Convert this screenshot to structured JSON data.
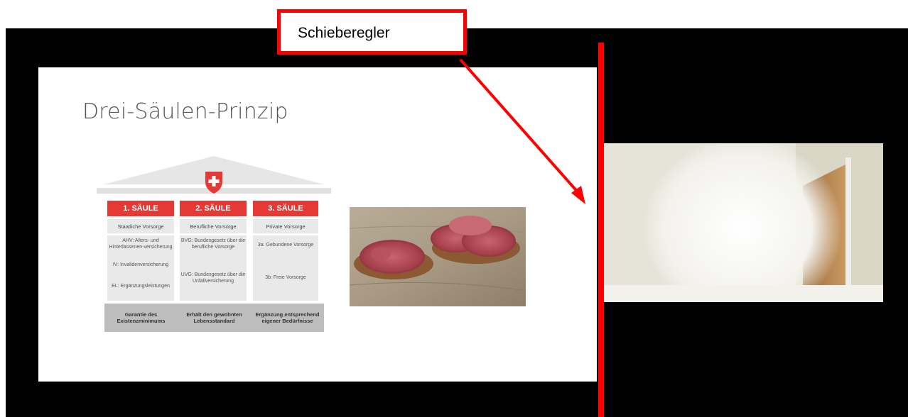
{
  "callout": {
    "label": "Schieberegler"
  },
  "slide": {
    "title": "Drei-Säulen-Prinzip",
    "columns": [
      {
        "header": "1. SÄULE",
        "subheader": "Staatliche Vorsorge",
        "items": [
          "AHV: Alters- und Hinterlassenen-versicherung",
          "IV: Invalidenversicherung",
          "EL: Ergänzungsleistungen"
        ],
        "footer": "Garantie des Existenzminimums"
      },
      {
        "header": "2. SÄULE",
        "subheader": "Berufliche Vorsorge",
        "items": [
          "BVG: Bundesgesetz über die berufliche Vorsorge",
          "UVG: Bundesgesetz über die Unfallversicherung"
        ],
        "footer": "Erhält den gewohnten Lebensstandard"
      },
      {
        "header": "3. SÄULE",
        "subheader": "Private Vorsorge",
        "items": [
          "3a: Gebundene Vorsorge",
          "3b: Freie Vorsorge"
        ],
        "footer": "Ergänzung entsprechend eigener Bedürfnisse"
      }
    ]
  },
  "colors": {
    "accent": "#ff0000",
    "column_header": "#e53935",
    "background": "#000000"
  },
  "icons": {
    "roof_emblem": "swiss-cross-icon"
  }
}
